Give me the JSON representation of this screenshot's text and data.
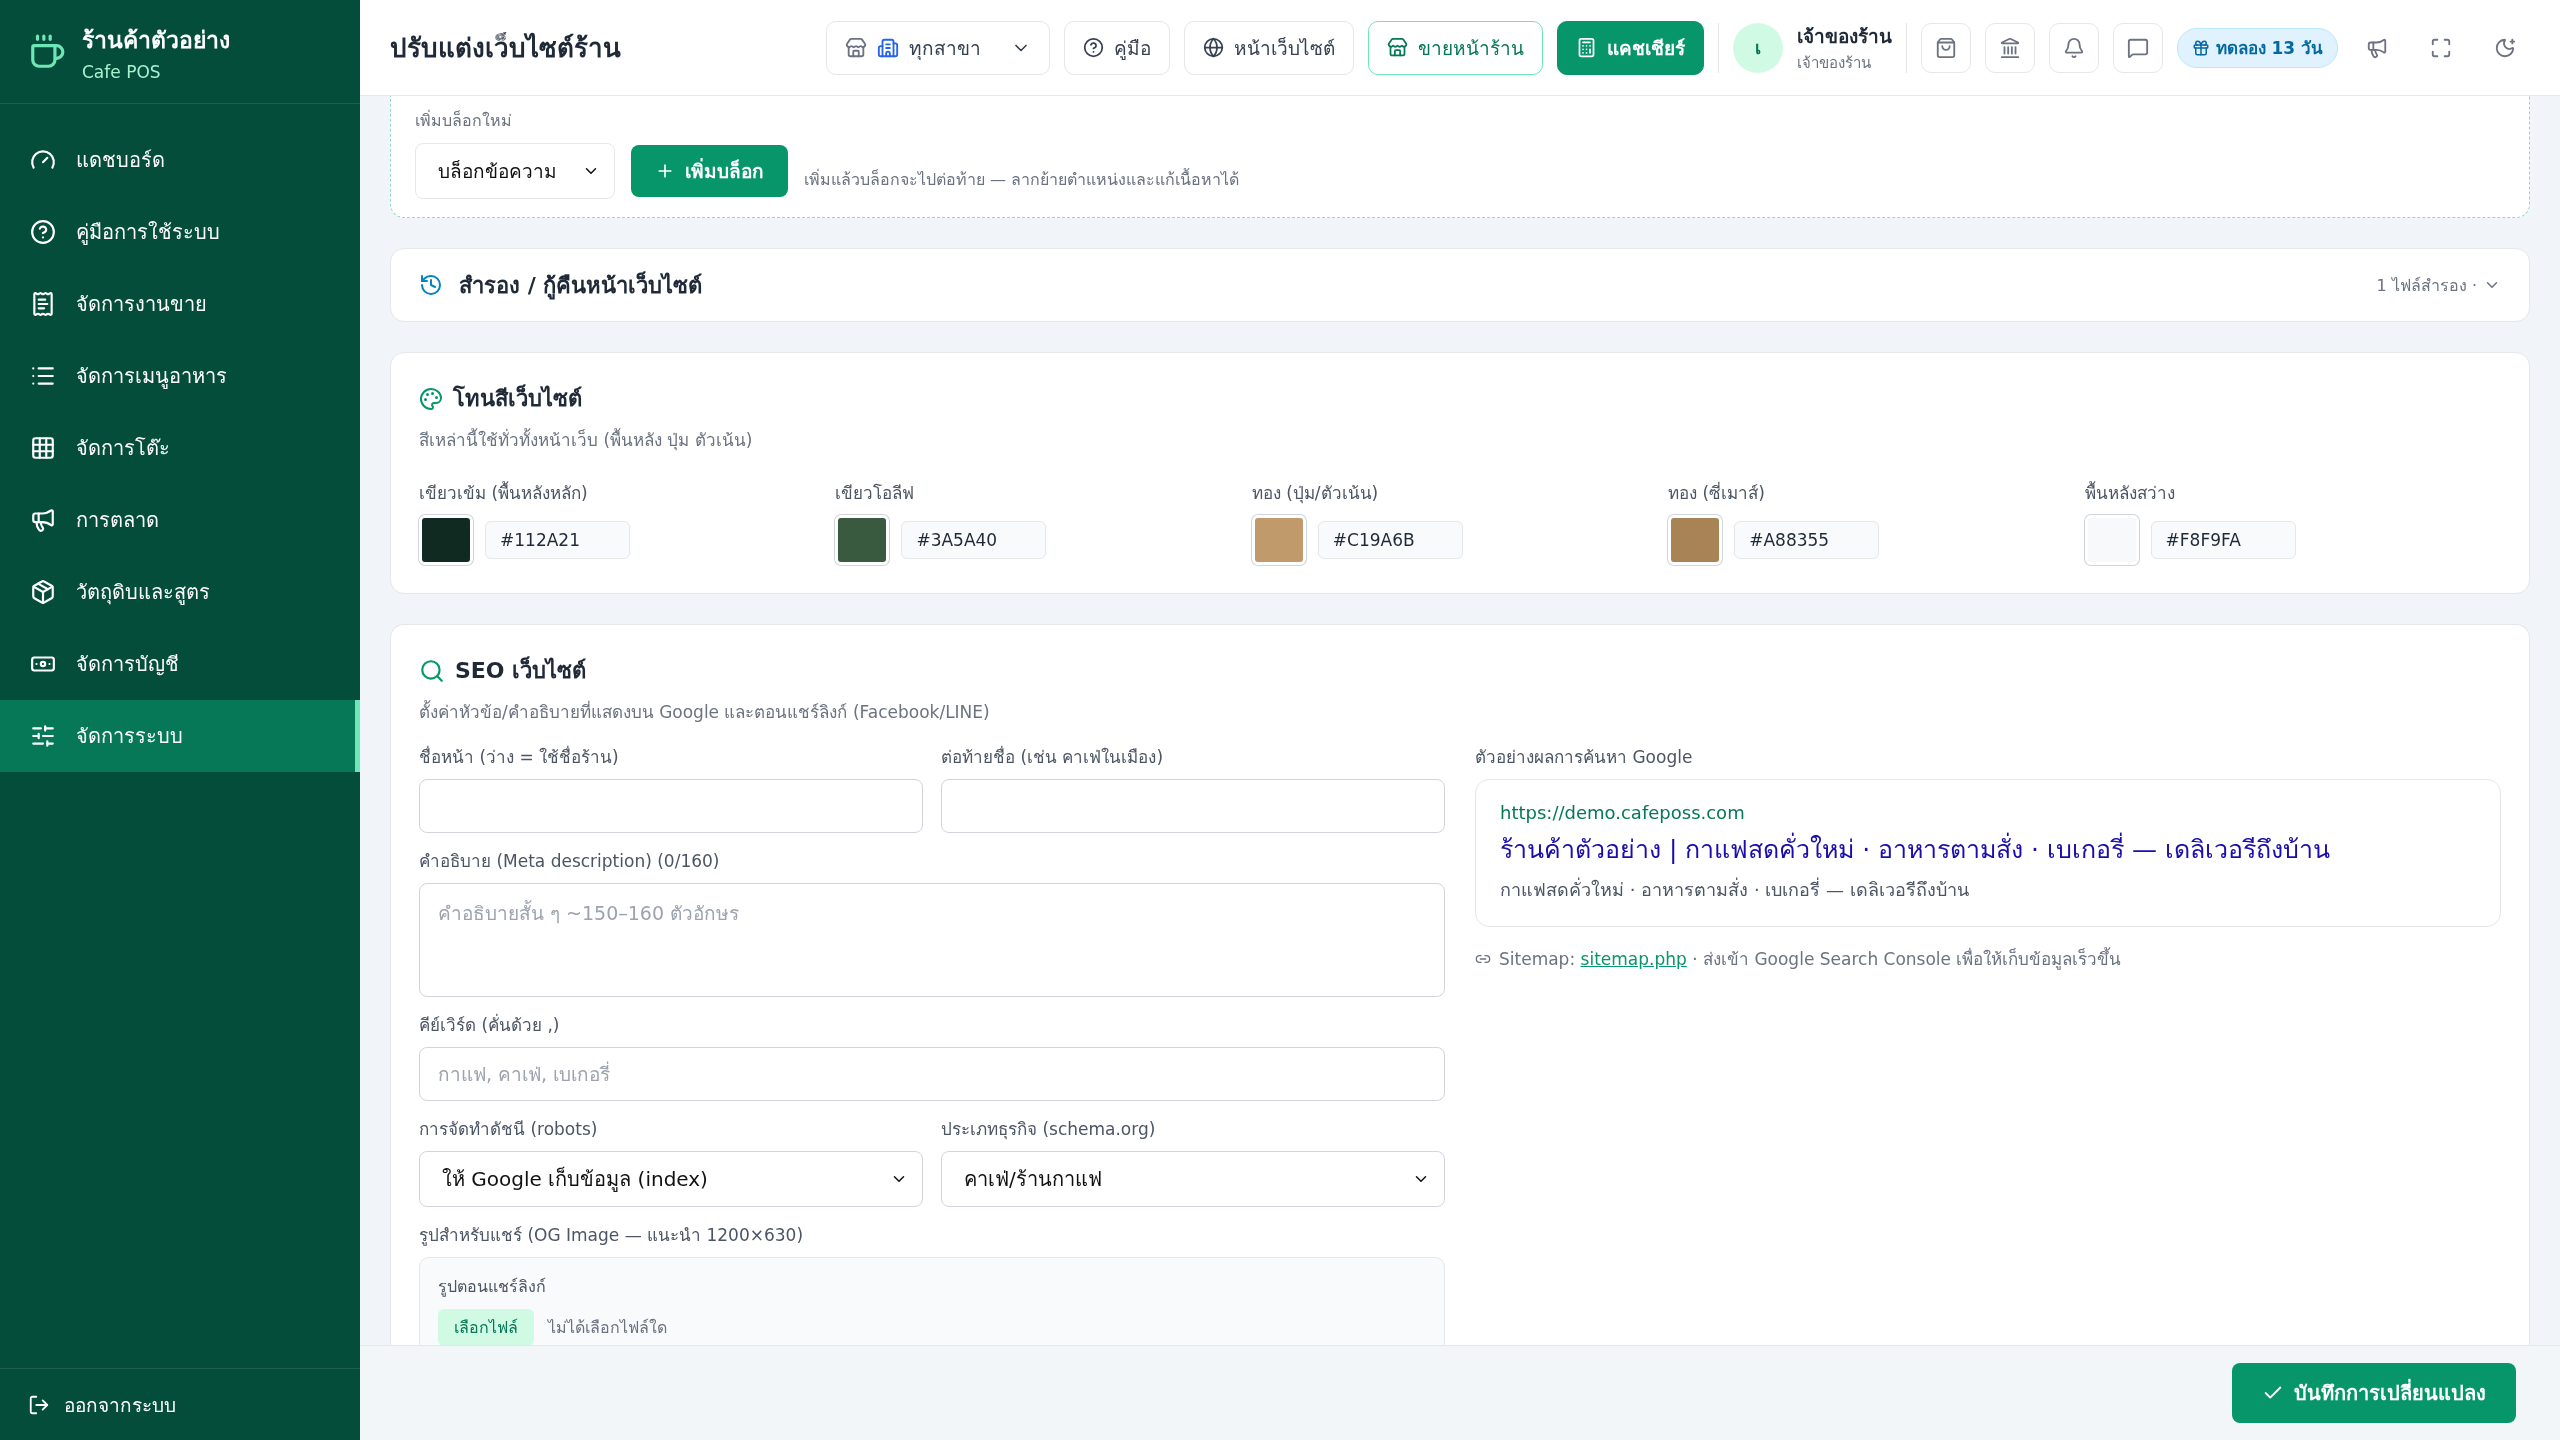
{
  "sidebar": {
    "brand": {
      "name": "ร้านค้าตัวอย่าง",
      "subtitle": "Cafe POS"
    },
    "items": [
      {
        "label": "แดชบอร์ด",
        "selected": false
      },
      {
        "label": "คู่มือการใช้ระบบ",
        "selected": false
      },
      {
        "label": "จัดการงานขาย",
        "selected": false
      },
      {
        "label": "จัดการเมนูอาหาร",
        "selected": false
      },
      {
        "label": "จัดการโต๊ะ",
        "selected": false
      },
      {
        "label": "การตลาด",
        "selected": false
      },
      {
        "label": "วัตถุดิบและสูตร",
        "selected": false
      },
      {
        "label": "จัดการบัญชี",
        "selected": false
      },
      {
        "label": "จัดการระบบ",
        "selected": true
      }
    ],
    "logout": "ออกจากระบบ"
  },
  "topbar": {
    "title": "ปรับแต่งเว็บไซต์ร้าน",
    "branch": "ทุกสาขา",
    "buttons": [
      {
        "label": "คู่มือ",
        "kind": "outline"
      },
      {
        "label": "หน้าเว็บไซต์",
        "kind": "outline"
      },
      {
        "label": "ขายหน้าร้าน",
        "kind": "accent"
      },
      {
        "label": "แคชเชียร์",
        "kind": "primary"
      }
    ],
    "user": {
      "initial": "เ",
      "name": "เจ้าของร้าน",
      "role": "เจ้าของร้าน"
    },
    "trial": "ทดลอง 13 วัน"
  },
  "add_block": {
    "label": "เพิ่มบล็อกใหม่",
    "type": "บล็อกข้อความ",
    "button": "เพิ่มบล็อก",
    "hint": "เพิ่มแล้วบล็อกจะไปต่อท้าย — ลากย้ายตำแหน่งและแก้เนื้อหาได้"
  },
  "backup": {
    "title": "สำรอง / กู้คืนหน้าเว็บไซต์",
    "meta": "1 ไฟล์สำรอง ·",
    "expanded": false
  },
  "colors": {
    "title": "โทนสีเว็บไซต์",
    "subtitle": "สีเหล่านี้ใช้ทั่วทั้งหน้าเว็บ (พื้นหลัง ปุ่ม ตัวเน้น)",
    "items": [
      {
        "label": "เขียวเข้ม (พื้นหลังหลัก)",
        "value": "#112A21",
        "color": "#112a21"
      },
      {
        "label": "เขียวโอลีฟ",
        "value": "#3A5A40",
        "color": "#3a5a40"
      },
      {
        "label": "ทอง (ปุ่ม/ตัวเน้น)",
        "value": "#C19A6B",
        "color": "#c19a6b"
      },
      {
        "label": "ทอง (ซี่เมาส์)",
        "value": "#A88355",
        "color": "#a88355"
      },
      {
        "label": "พื้นหลังสว่าง",
        "value": "#F8F9FA",
        "color": "#f8f9fa"
      }
    ]
  },
  "seo": {
    "title": "SEO เว็บไซต์",
    "subtitle": "ตั้งค่าหัวข้อ/คำอธิบายที่แสดงบน Google และตอนแชร์ลิงก์ (Facebook/LINE)",
    "page_title_label": "ชื่อหน้า (ว่าง = ใช้ชื่อร้าน)",
    "suffix_label": "ต่อท้ายชื่อ (เช่น คาเฟ่ในเมือง)",
    "description_label": "คำอธิบาย (Meta description) (0/160)",
    "description_placeholder": "คำอธิบายสั้น ๆ ~150–160 ตัวอักษร",
    "keywords_label": "คีย์เวิร์ด (คั่นด้วย ,)",
    "keywords_placeholder": "กาแฟ, คาเฟ่, เบเกอรี่",
    "robots_label": "การจัดทำดัชนี (robots)",
    "robots_value": "ให้ Google เก็บข้อมูล (index)",
    "business_label": "ประเภทธุรกิจ (schema.org)",
    "business_value": "คาเฟ่/ร้านกาแฟ",
    "og_label": "รูปสำหรับแชร์ (OG Image — แนะนำ 1200×630)",
    "og_box_label": "รูปตอนแชร์ลิงก์",
    "file_button": "เลือกไฟล์",
    "file_status": "ไม่ได้เลือกไฟล์ใด",
    "preview_label": "ตัวอย่างผลการค้นหา Google",
    "preview": {
      "url": "https://demo.cafeposs.com",
      "title": "ร้านค้าตัวอย่าง | กาแฟสดคั่วใหม่ · อาหารตามสั่ง · เบเกอรี่ — เดลิเวอรีถึงบ้าน",
      "description": "กาแฟสดคั่วใหม่ · อาหารตามสั่ง · เบเกอรี่ — เดลิเวอรีถึงบ้าน"
    },
    "sitemap": {
      "prefix": "Sitemap:",
      "link": "sitemap.php",
      "suffix": "· ส่งเข้า Google Search Console เพื่อให้เก็บข้อมูลเร็วขึ้น"
    }
  },
  "save_button": "บันทึกการเปลี่ยนแปลง"
}
